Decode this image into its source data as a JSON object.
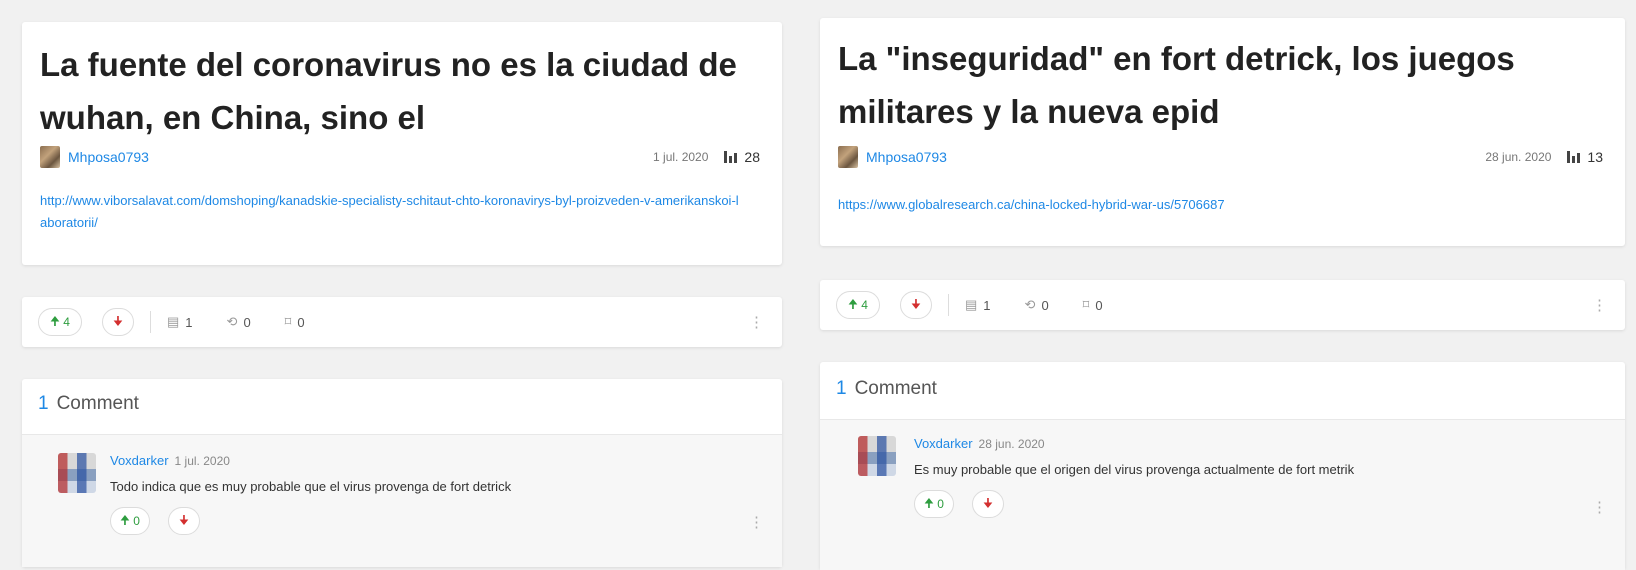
{
  "posts": [
    {
      "title": "La fuente del coronavirus no es la ciudad de wuhan, en China, sino el",
      "author": "Mhposa0793",
      "date": "1 jul. 2020",
      "views": "28",
      "url": "http://www.viborsalavat.com/domshoping/kanadskie-specialisty-schitaut-chto-koronavirys-byl-proizveden-v-amerikanskoi-laboratorii/",
      "upvotes": "4",
      "comments": "1",
      "reposts": "0",
      "bookmarks": "0",
      "comments_count": "1",
      "comments_label": "Comment",
      "comment": {
        "author": "Voxdarker",
        "date": "1 jul. 2020",
        "text": "Todo indica que es muy probable que el virus provenga de fort detrick",
        "upvotes": "0"
      }
    },
    {
      "title": "La \"inseguridad\" en fort detrick, los juegos militares y la nueva epid",
      "author": "Mhposa0793",
      "date": "28 jun. 2020",
      "views": "13",
      "url": "https://www.globalresearch.ca/china-locked-hybrid-war-us/5706687",
      "upvotes": "4",
      "comments": "1",
      "reposts": "0",
      "bookmarks": "0",
      "comments_count": "1",
      "comments_label": "Comment",
      "comment": {
        "author": "Voxdarker",
        "date": "28 jun. 2020",
        "text": "Es muy probable que el origen del virus provenga actualmente de fort metrik",
        "upvotes": "0"
      }
    }
  ],
  "icons": {
    "up": "🠉",
    "down": "🠋",
    "comment": "▤",
    "repost": "⟲",
    "bookmark": "⌑",
    "kebab": "⋮"
  },
  "colors": {
    "link": "#1e88e5",
    "up": "#2e9d3f",
    "down": "#d32f2f"
  }
}
